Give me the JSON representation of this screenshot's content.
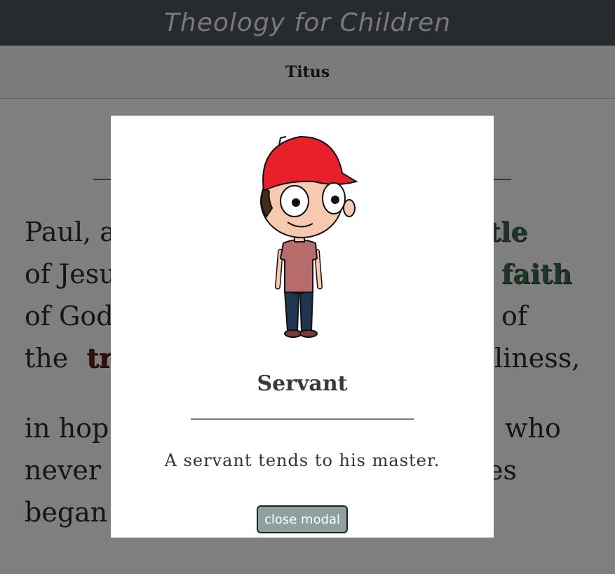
{
  "header": {
    "site_title": "Theology for Children"
  },
  "subheader": {
    "book_title": "Titus"
  },
  "verses": {
    "line1_start": "Paul, a",
    "line1_end": "stle",
    "line2_start": "of Jesu",
    "line2_end": "faith",
    "line3_start": "of God",
    "line3_end": "of",
    "line4_start": "the",
    "line4_word": "tru",
    "line4_end": "liness,",
    "line5_start": "in hop",
    "line5_end": "who",
    "line6_start": "never",
    "line6_end": "es",
    "line7_start": "began"
  },
  "modal": {
    "image_icon": "servant-character-illustration",
    "title": "Servant",
    "description": "A servant tends to his master.",
    "close_label": "close modal"
  },
  "colors": {
    "header_bg": "#4f565f",
    "overlay": "rgba(0,0,0,0.5)",
    "button_bg": "#8fa0a0",
    "highlight_green": "#3e6b4e",
    "highlight_red": "#6b1f1f"
  }
}
